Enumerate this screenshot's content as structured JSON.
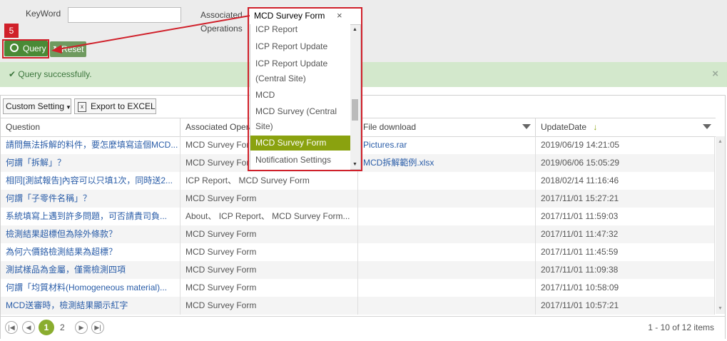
{
  "search": {
    "keyword_label": "KeyWord",
    "keyword_value": "",
    "assoc_label": "Associated Operations",
    "assoc_value": "MCD Survey Form",
    "clear_label": "×",
    "query_label": "Query",
    "reset_label": "Reset",
    "step_badge": "5"
  },
  "alert": {
    "message": "Query successfully.",
    "close": "×"
  },
  "toolbar": {
    "custom_setting": "Custom Setting",
    "export": "Export to EXCEL"
  },
  "dropdown": {
    "items": [
      "ICP Report",
      "ICP Report Update",
      "ICP Report Update (Central Site)",
      "MCD",
      "MCD Survey (Central Site)",
      "MCD Survey Form",
      "Notification Settings"
    ],
    "selected": "MCD Survey Form"
  },
  "table": {
    "headers": [
      "Question",
      "Associated Operations",
      "File download",
      "UpdateDate"
    ],
    "rows": [
      [
        "請問無法拆解的料件，要怎麼填寫這個MCD...",
        "MCD Survey Form",
        "Pictures.rar",
        "2019/06/19 14:21:05"
      ],
      [
        "何謂「拆解」？",
        "MCD Survey Form",
        "MCD拆解範例.xlsx",
        "2019/06/06 15:05:29"
      ],
      [
        "相同[測試報告]內容可以只填1次，同時送2...",
        "ICP Report、 MCD Survey Form",
        "",
        "2018/02/14 11:16:46"
      ],
      [
        "何謂「子零件名稱」？",
        "MCD Survey Form",
        "",
        "2017/11/01 15:27:21"
      ],
      [
        "系統填寫上遇到許多問題，可否請貴司負...",
        "About、 ICP Report、 MCD Survey Form...",
        "",
        "2017/11/01 11:59:03"
      ],
      [
        "檢測結果超標但為除外條款？",
        "MCD Survey Form",
        "",
        "2017/11/01 11:47:32"
      ],
      [
        "為何六價鉻檢測結果為超標？",
        "MCD Survey Form",
        "",
        "2017/11/01 11:45:59"
      ],
      [
        "測試樣品為金屬，僅需檢測四項",
        "MCD Survey Form",
        "",
        "2017/11/01 11:09:38"
      ],
      [
        "何謂「均質材料(Homogeneous material)...",
        "MCD Survey Form",
        "",
        "2017/11/01 10:58:09"
      ],
      [
        "MCD送審時，檢測結果顯示紅字",
        "MCD Survey Form",
        "",
        "2017/11/01 10:57:21"
      ]
    ]
  },
  "pager": {
    "pages": [
      "1",
      "2"
    ],
    "current": "1",
    "summary": "1 - 10 of 12 items"
  },
  "colors": {
    "green": "#4a8a36",
    "highlight": "#d0202a",
    "selected": "#8aa20f",
    "link": "#2a5da8"
  }
}
